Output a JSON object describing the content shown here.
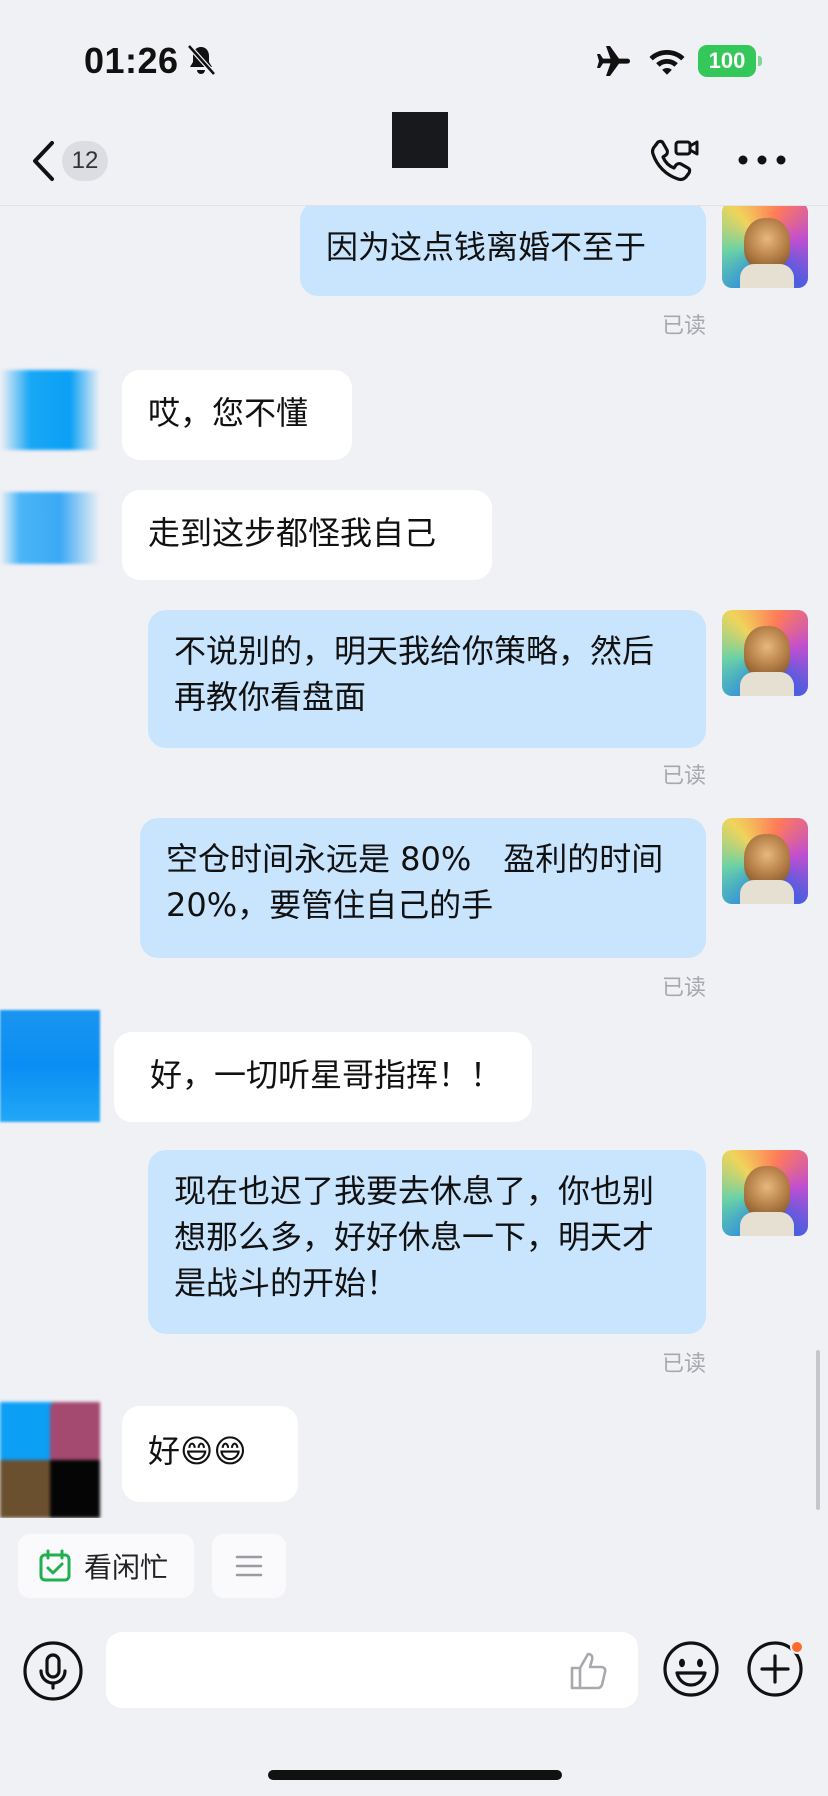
{
  "status_bar": {
    "time": "01:26",
    "battery": "100"
  },
  "nav": {
    "unread_count": "12"
  },
  "messages": [
    {
      "sender": "me",
      "text": "因为这点钱离婚不至于",
      "receipt": "已读"
    },
    {
      "sender": "them",
      "text": "哎，您不懂"
    },
    {
      "sender": "them",
      "text": "走到这步都怪我自己"
    },
    {
      "sender": "me",
      "text": "不说别的，明天我给你策略，然后再教你看盘面",
      "receipt": "已读"
    },
    {
      "sender": "me",
      "text": "空仓时间永远是 80%　盈利的时间 20%，要管住自己的手",
      "receipt": "已读"
    },
    {
      "sender": "them",
      "text": "好，一切听星哥指挥！！"
    },
    {
      "sender": "me",
      "text": "现在也迟了我要去休息了，你也别想那么多，好好休息一下，明天才是战斗的开始！",
      "receipt": "已读"
    },
    {
      "sender": "them",
      "text": "好😄😄"
    }
  ],
  "quick_actions": {
    "busy_status_label": "看闲忙"
  },
  "input": {
    "value": "",
    "placeholder": ""
  },
  "icons": {
    "status": [
      "bell-slash-icon",
      "airplane-icon",
      "wifi-icon"
    ],
    "nav": [
      "back-chevron-icon",
      "video-call-icon",
      "more-icon"
    ],
    "input": [
      "microphone-icon",
      "thumbs-up-icon",
      "emoji-icon",
      "plus-icon"
    ]
  },
  "colors": {
    "background": "#f0f1f5",
    "my_bubble": "#c9e4fd",
    "their_bubble": "#ffffff",
    "battery": "#34c759",
    "notification_dot": "#ff6b2c"
  }
}
